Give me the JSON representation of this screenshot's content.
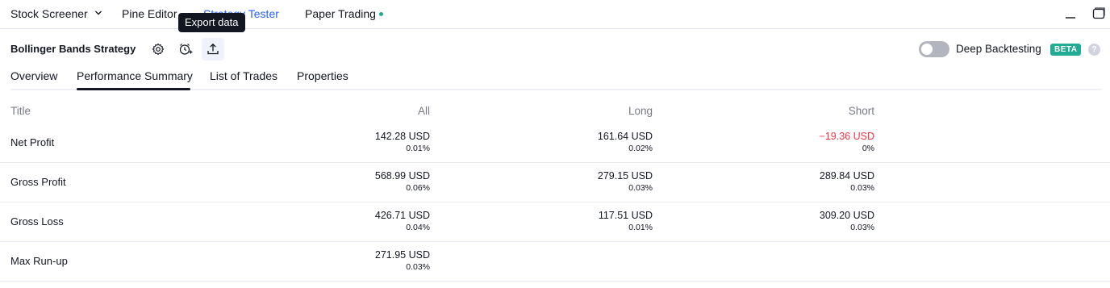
{
  "topnav": {
    "items": [
      {
        "label": "Stock Screener"
      },
      {
        "label": "Pine Editor"
      },
      {
        "label": "Strategy Tester"
      },
      {
        "label": "Paper Trading"
      }
    ],
    "status_dot_color": "#22ab94"
  },
  "tooltip": {
    "text": "Export data"
  },
  "strategy": {
    "title": "Bollinger Bands Strategy",
    "deep_backtesting_label": "Deep Backtesting",
    "beta_badge": "BETA",
    "help": "?"
  },
  "tabs": [
    {
      "label": "Overview"
    },
    {
      "label": "Performance Summary"
    },
    {
      "label": "List of Trades"
    },
    {
      "label": "Properties"
    }
  ],
  "table": {
    "headers": {
      "title": "Title",
      "all": "All",
      "long": "Long",
      "short": "Short"
    },
    "rows": [
      {
        "title": "Net Profit",
        "all": {
          "value": "142.28 USD",
          "pct": "0.01%"
        },
        "long": {
          "value": "161.64 USD",
          "pct": "0.02%"
        },
        "short": {
          "value": "−19.36 USD",
          "pct": "0%"
        }
      },
      {
        "title": "Gross Profit",
        "all": {
          "value": "568.99 USD",
          "pct": "0.06%"
        },
        "long": {
          "value": "279.15 USD",
          "pct": "0.03%"
        },
        "short": {
          "value": "289.84 USD",
          "pct": "0.03%"
        }
      },
      {
        "title": "Gross Loss",
        "all": {
          "value": "426.71 USD",
          "pct": "0.04%"
        },
        "long": {
          "value": "117.51 USD",
          "pct": "0.01%"
        },
        "short": {
          "value": "309.20 USD",
          "pct": "0.03%"
        }
      },
      {
        "title": "Max Run-up",
        "all": {
          "value": "271.95 USD",
          "pct": "0.03%"
        }
      }
    ]
  },
  "colors": {
    "accent": "#2962ff",
    "negative": "#f23645",
    "beta": "#22ab94"
  }
}
